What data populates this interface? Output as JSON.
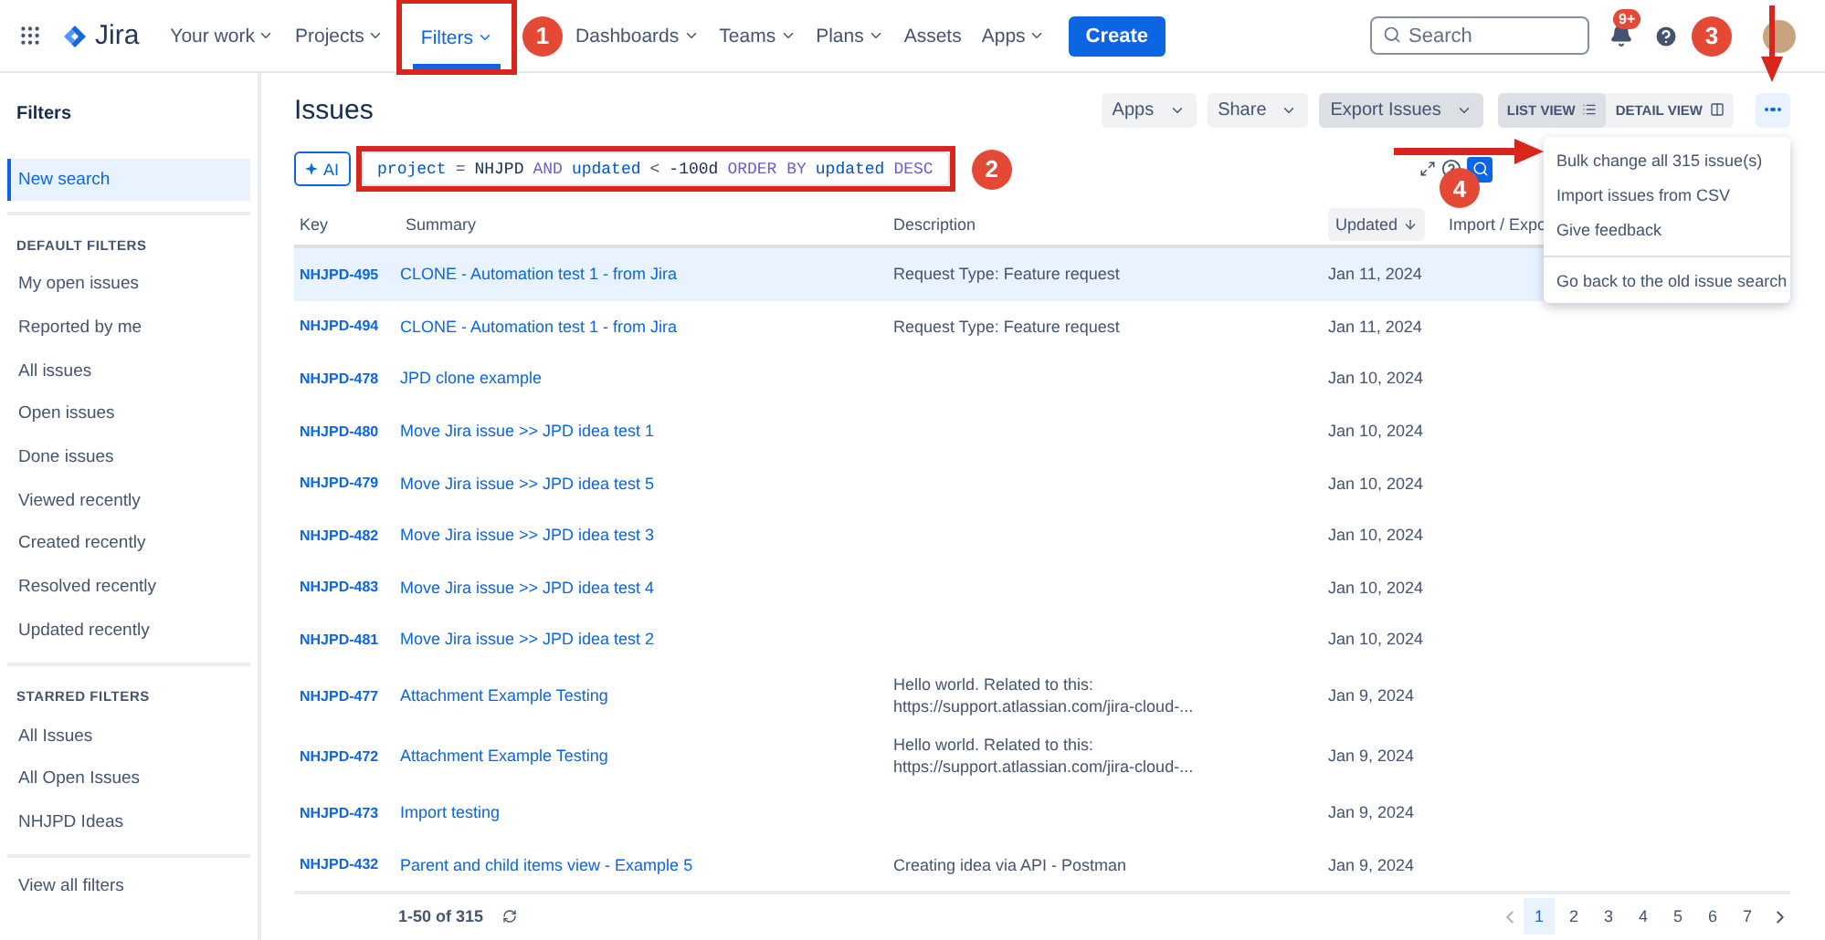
{
  "nav": {
    "product": "Jira",
    "items": [
      {
        "label": "Your work",
        "dropdown": true,
        "selected": false
      },
      {
        "label": "Projects",
        "dropdown": true,
        "selected": false
      },
      {
        "label": "Filters",
        "dropdown": true,
        "selected": true
      },
      {
        "label": "Dashboards",
        "dropdown": true,
        "selected": false
      },
      {
        "label": "Teams",
        "dropdown": true,
        "selected": false
      },
      {
        "label": "Plans",
        "dropdown": true,
        "selected": false
      },
      {
        "label": "Assets",
        "dropdown": false,
        "selected": false
      },
      {
        "label": "Apps",
        "dropdown": true,
        "selected": false
      }
    ],
    "create": "Create",
    "search": {
      "placeholder": "Search"
    },
    "notifications_badge": "9+"
  },
  "sidebar": {
    "title": "Filters",
    "top_items": [
      {
        "label": "New search",
        "selected": true
      }
    ],
    "sections": [
      {
        "heading": "DEFAULT FILTERS",
        "items": [
          "My open issues",
          "Reported by me",
          "All issues",
          "Open issues",
          "Done issues",
          "Viewed recently",
          "Created recently",
          "Resolved recently",
          "Updated recently"
        ]
      },
      {
        "heading": "STARRED FILTERS",
        "items": [
          "All Issues",
          "All Open Issues",
          "NHJPD Ideas"
        ]
      }
    ],
    "footer": "View all filters"
  },
  "page": {
    "title": "Issues",
    "actions": [
      "Apps",
      "Share",
      "Export Issues"
    ],
    "views": [
      {
        "label": "LIST VIEW",
        "selected": true
      },
      {
        "label": "DETAIL VIEW",
        "selected": false
      }
    ]
  },
  "query": {
    "ai_label": "AI",
    "tokens": [
      {
        "text": "project",
        "kind": "field"
      },
      {
        "text": "=",
        "kind": "operator"
      },
      {
        "text": "NHJPD",
        "kind": "value"
      },
      {
        "text": "AND",
        "kind": "keyword"
      },
      {
        "text": "updated",
        "kind": "field"
      },
      {
        "text": "<",
        "kind": "operator"
      },
      {
        "text": "-100d",
        "kind": "value"
      },
      {
        "text": "ORDER BY",
        "kind": "keyword"
      },
      {
        "text": "updated",
        "kind": "field"
      },
      {
        "text": "DESC",
        "kind": "keyword"
      }
    ]
  },
  "table": {
    "columns": [
      {
        "label": "Key",
        "sorted": false
      },
      {
        "label": "Summary",
        "sorted": false
      },
      {
        "label": "Description",
        "sorted": false
      },
      {
        "label": "Updated",
        "sorted": true
      },
      {
        "label": "Import / Expo",
        "sorted": false
      }
    ],
    "rows": [
      {
        "key": "NHJPD-495",
        "summary": "CLONE - Automation test 1 - from Jira",
        "description": [
          "Request Type: Feature request"
        ],
        "updated": "Jan 11, 2024",
        "selected": true
      },
      {
        "key": "NHJPD-494",
        "summary": "CLONE - Automation test 1 - from Jira",
        "description": [
          "Request Type: Feature request"
        ],
        "updated": "Jan 11, 2024",
        "selected": false
      },
      {
        "key": "NHJPD-478",
        "summary": "JPD clone example",
        "description": [],
        "updated": "Jan 10, 2024",
        "selected": false
      },
      {
        "key": "NHJPD-480",
        "summary": "Move Jira issue >> JPD idea test 1",
        "description": [],
        "updated": "Jan 10, 2024",
        "selected": false
      },
      {
        "key": "NHJPD-479",
        "summary": "Move Jira issue >> JPD idea test 5",
        "description": [],
        "updated": "Jan 10, 2024",
        "selected": false
      },
      {
        "key": "NHJPD-482",
        "summary": "Move Jira issue >> JPD idea test 3",
        "description": [],
        "updated": "Jan 10, 2024",
        "selected": false
      },
      {
        "key": "NHJPD-483",
        "summary": "Move Jira issue >> JPD idea test 4",
        "description": [],
        "updated": "Jan 10, 2024",
        "selected": false
      },
      {
        "key": "NHJPD-481",
        "summary": "Move Jira issue >> JPD idea test 2",
        "description": [],
        "updated": "Jan 10, 2024",
        "selected": false
      },
      {
        "key": "NHJPD-477",
        "summary": "Attachment Example Testing",
        "description": [
          "Hello world. Related to this:",
          "https://support.atlassian.com/jira-cloud-..."
        ],
        "updated": "Jan 9, 2024",
        "selected": false
      },
      {
        "key": "NHJPD-472",
        "summary": "Attachment Example Testing",
        "description": [
          "Hello world. Related to this:",
          "https://support.atlassian.com/jira-cloud-..."
        ],
        "updated": "Jan 9, 2024",
        "selected": false
      },
      {
        "key": "NHJPD-473",
        "summary": "Import testing",
        "description": [],
        "updated": "Jan 9, 2024",
        "selected": false
      },
      {
        "key": "NHJPD-432",
        "summary": "Parent and child items view - Example 5",
        "description": [
          "Creating idea via API - Postman"
        ],
        "updated": "Jan 9, 2024",
        "selected": false
      }
    ]
  },
  "pagination": {
    "range": "1-50 of 315",
    "pages": [
      {
        "label": "1",
        "selected": true
      },
      {
        "label": "2",
        "selected": false
      },
      {
        "label": "3",
        "selected": false
      },
      {
        "label": "4",
        "selected": false
      },
      {
        "label": "5",
        "selected": false
      },
      {
        "label": "6",
        "selected": false
      },
      {
        "label": "7",
        "selected": false
      }
    ]
  },
  "menu": {
    "items": [
      {
        "label": "Bulk change all 315 issue(s)",
        "kind": "item"
      },
      {
        "label": "Import issues from CSV",
        "kind": "item"
      },
      {
        "label": "Give feedback",
        "kind": "item"
      },
      {
        "label": "Go back to the old issue search",
        "kind": "separated"
      }
    ]
  },
  "annotations": {
    "callouts": [
      "1",
      "2",
      "3",
      "4"
    ]
  }
}
